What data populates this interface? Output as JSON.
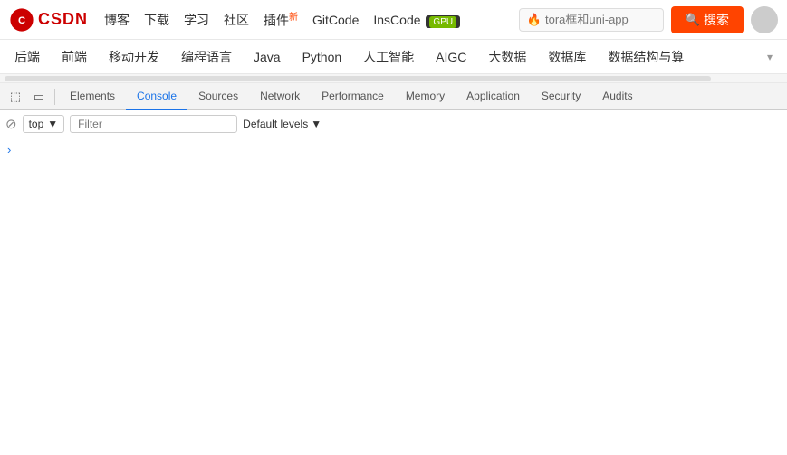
{
  "topnav": {
    "logo_text": "CSDN",
    "links": [
      {
        "label": "博客",
        "badge": null
      },
      {
        "label": "下载",
        "badge": null
      },
      {
        "label": "学习",
        "badge": null
      },
      {
        "label": "社区",
        "badge": null
      },
      {
        "label": "插件",
        "badge": "新"
      },
      {
        "label": "GitCode",
        "badge": null
      },
      {
        "label": "InsCode",
        "badge": "GPU"
      }
    ],
    "search_placeholder": "tora框和uni-app",
    "search_btn": "搜索"
  },
  "secondnav": {
    "items": [
      {
        "label": "后端",
        "highlight": false
      },
      {
        "label": "前端",
        "highlight": false
      },
      {
        "label": "移动开发",
        "highlight": false
      },
      {
        "label": "编程语言",
        "highlight": false
      },
      {
        "label": "Java",
        "highlight": false
      },
      {
        "label": "Python",
        "highlight": false
      },
      {
        "label": "人工智能",
        "highlight": false
      },
      {
        "label": "AIGC",
        "highlight": false
      },
      {
        "label": "大数据",
        "highlight": false
      },
      {
        "label": "数据库",
        "highlight": false
      },
      {
        "label": "数据结构与算",
        "highlight": false
      }
    ],
    "expand_icon": "▾"
  },
  "devtools": {
    "tabs": [
      {
        "label": "Elements",
        "active": false
      },
      {
        "label": "Console",
        "active": true
      },
      {
        "label": "Sources",
        "active": false
      },
      {
        "label": "Network",
        "active": false
      },
      {
        "label": "Performance",
        "active": false
      },
      {
        "label": "Memory",
        "active": false
      },
      {
        "label": "Application",
        "active": false
      },
      {
        "label": "Security",
        "active": false
      },
      {
        "label": "Audits",
        "active": false
      }
    ],
    "inspector_icon": "⬚",
    "mobile_icon": "▭",
    "context_value": "top",
    "filter_placeholder": "Filter",
    "levels_label": "Default levels",
    "console_arrow": "›",
    "no_entry_icon": "⊘"
  }
}
